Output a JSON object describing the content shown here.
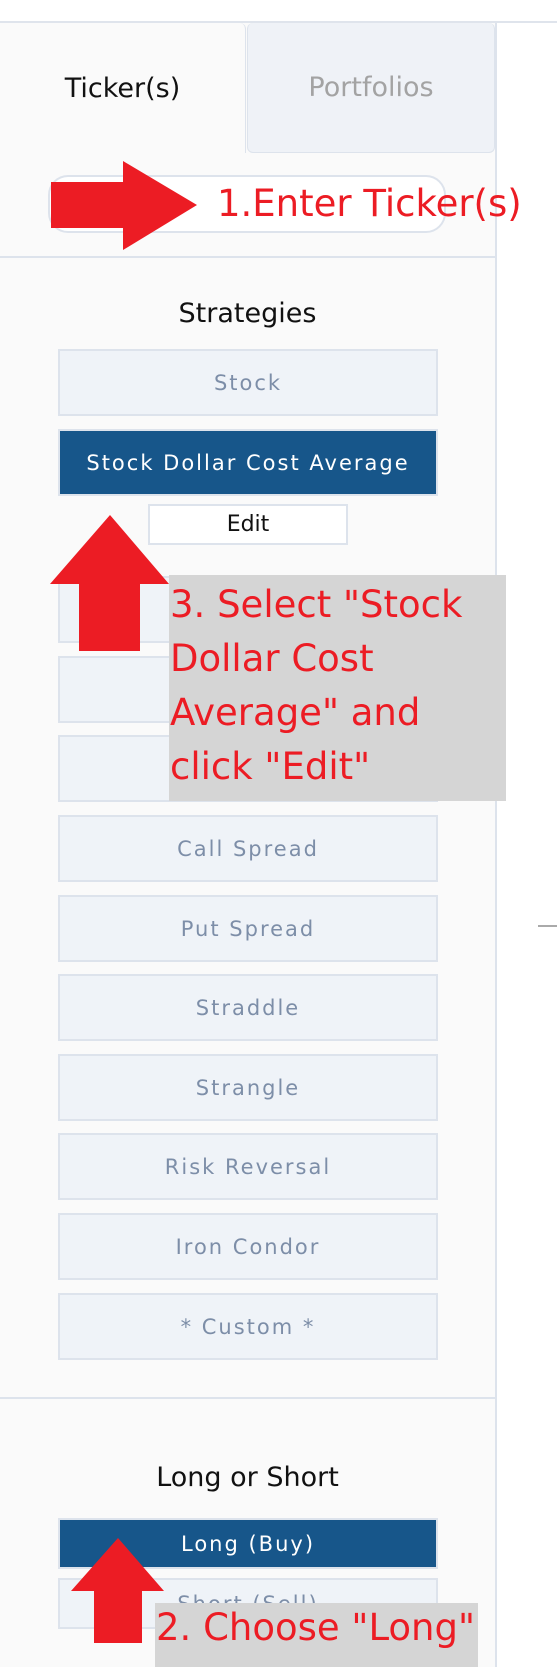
{
  "tabs": [
    {
      "label": "Ticker(s)",
      "active": true
    },
    {
      "label": "Portfolios",
      "active": false
    }
  ],
  "ticker_input": {
    "value": "",
    "placeholder": ""
  },
  "strategies": {
    "title": "Strategies",
    "items": [
      {
        "label": "Stock",
        "selected": false
      },
      {
        "label": "Stock Dollar Cost Average",
        "selected": true
      },
      {
        "label": "",
        "selected": false
      },
      {
        "label": "",
        "selected": false
      },
      {
        "label": "",
        "selected": false
      },
      {
        "label": "Call Spread",
        "selected": false
      },
      {
        "label": "Put Spread",
        "selected": false
      },
      {
        "label": "Straddle",
        "selected": false
      },
      {
        "label": "Strangle",
        "selected": false
      },
      {
        "label": "Risk Reversal",
        "selected": false
      },
      {
        "label": "Iron Condor",
        "selected": false
      },
      {
        "label": "* Custom *",
        "selected": false
      }
    ],
    "edit_label": "Edit"
  },
  "long_short": {
    "title": "Long or Short",
    "options": [
      {
        "label": "Long (Buy)",
        "selected": true
      },
      {
        "label": "Short (Sell)",
        "selected": false
      }
    ]
  },
  "annotations": {
    "step1": "1.Enter Ticker(s)",
    "step2": "2. Choose \"Long\"",
    "step3_lines": [
      "3. Select \"Stock",
      "Dollar Cost",
      "Average\" and",
      "click \"Edit\""
    ]
  },
  "colors": {
    "accent": "#17568a",
    "annotation_red": "#ec1c24",
    "annotation_bg": "#d5d5d5",
    "button_bg": "#eff3f8",
    "button_text": "#7d8ea8",
    "border": "#dde3ec"
  }
}
